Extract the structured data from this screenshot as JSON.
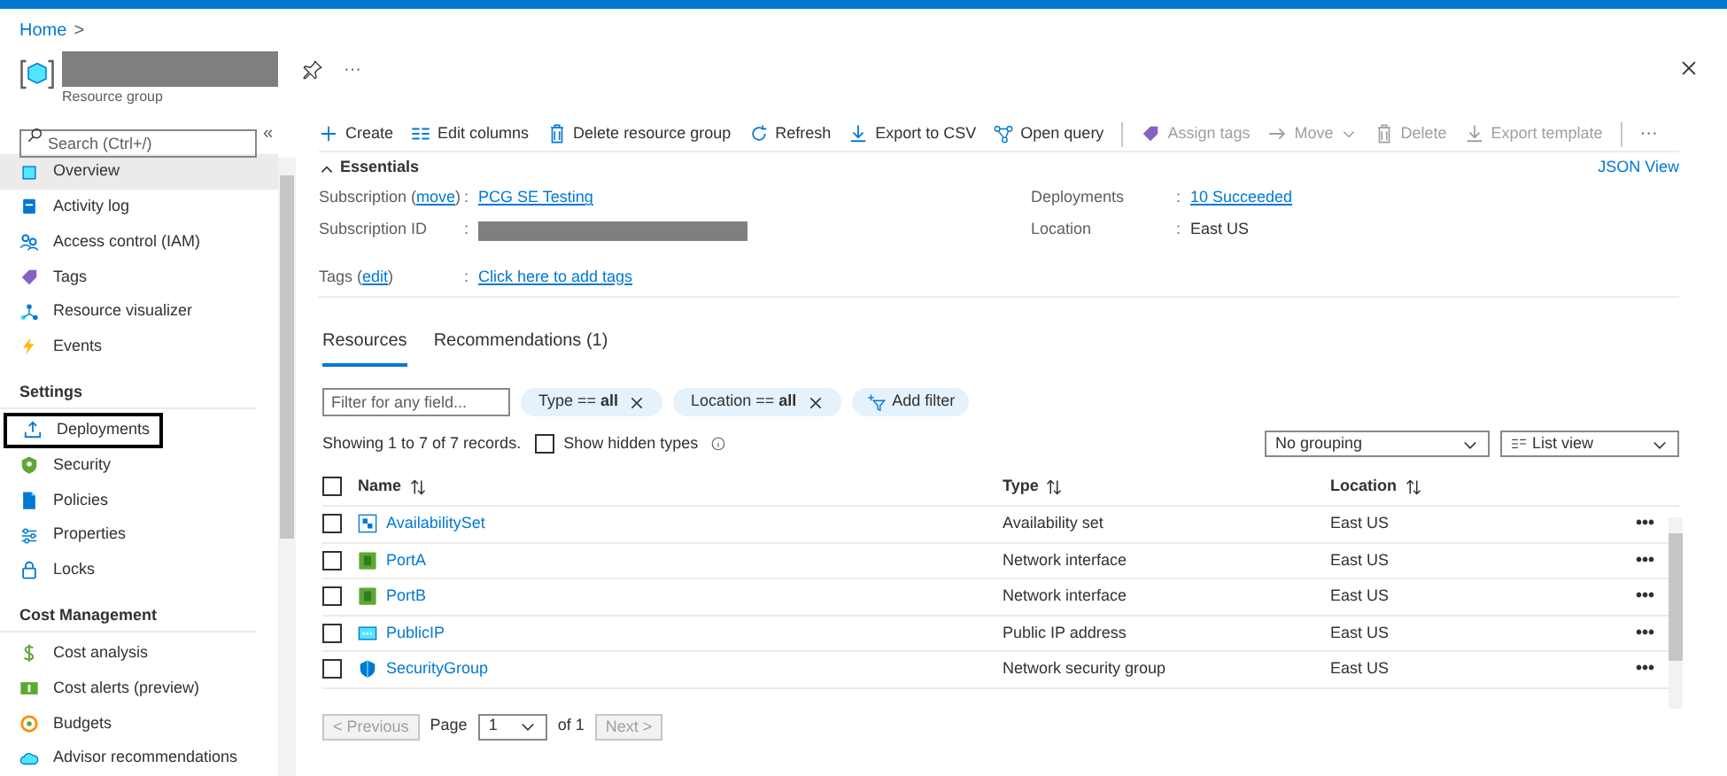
{
  "breadcrumb": [
    "Home",
    ">"
  ],
  "header": {
    "subtitle": "Resource group",
    "more": "···"
  },
  "sidebar": {
    "search_placeholder": "Search (Ctrl+/)",
    "collapse": "«",
    "sections": [
      {
        "items": [
          {
            "label": "Overview",
            "selected": true,
            "highlighted": false
          },
          {
            "label": "Activity log",
            "selected": false,
            "highlighted": false
          },
          {
            "label": "Access control (IAM)",
            "selected": false,
            "highlighted": false
          },
          {
            "label": "Tags",
            "selected": false,
            "highlighted": false
          },
          {
            "label": "Resource visualizer",
            "selected": false,
            "highlighted": false
          },
          {
            "label": "Events",
            "selected": false,
            "highlighted": false
          }
        ]
      },
      {
        "title": "Settings",
        "items": [
          {
            "label": "Deployments",
            "selected": false,
            "highlighted": true
          },
          {
            "label": "Security",
            "selected": false,
            "highlighted": false
          },
          {
            "label": "Policies",
            "selected": false,
            "highlighted": false
          },
          {
            "label": "Properties",
            "selected": false,
            "highlighted": false
          },
          {
            "label": "Locks",
            "selected": false,
            "highlighted": false
          }
        ]
      },
      {
        "title": "Cost Management",
        "items": [
          {
            "label": "Cost analysis",
            "selected": false,
            "highlighted": false
          },
          {
            "label": "Cost alerts (preview)",
            "selected": false,
            "highlighted": false
          },
          {
            "label": "Budgets",
            "selected": false,
            "highlighted": false
          },
          {
            "label": "Advisor recommendations",
            "selected": false,
            "highlighted": false
          }
        ]
      }
    ]
  },
  "toolbar": [
    {
      "label": "Create",
      "disabled": false
    },
    {
      "label": "Edit columns",
      "disabled": false
    },
    {
      "label": "Delete resource group",
      "disabled": false
    },
    {
      "label": "Refresh",
      "disabled": false
    },
    {
      "label": "Export to CSV",
      "disabled": false
    },
    {
      "label": "Open query",
      "disabled": false
    },
    {
      "label": "Assign tags",
      "disabled": true
    },
    {
      "label": "Move",
      "disabled": true
    },
    {
      "label": "Delete",
      "disabled": true
    },
    {
      "label": "Export template",
      "disabled": true
    }
  ],
  "toolbar_more": "···",
  "essentials": {
    "title": "Essentials",
    "json_view": "JSON View",
    "subscription": {
      "label": "Subscription (",
      "link": "move",
      "after_link": ")",
      "colon": ":",
      "value": "PCG SE Testing"
    },
    "subscription_id": {
      "label": "Subscription ID",
      "colon": ":"
    },
    "tags": {
      "label": "Tags (",
      "link": "edit",
      "after_link": ")",
      "colon": ":",
      "value": "Click here to add tags"
    },
    "deployments": {
      "label": "Deployments",
      "colon": ":",
      "value": "10 Succeeded"
    },
    "location": {
      "label": "Location",
      "colon": ":",
      "value": "East US"
    }
  },
  "tabs": [
    {
      "label": "Resources",
      "selected": true
    },
    {
      "label": "Recommendations (1)",
      "selected": false
    }
  ],
  "filter": {
    "placeholder": "Filter for any field...",
    "pills": [
      {
        "key": "Type ==",
        "value": "all"
      },
      {
        "key": "Location ==",
        "value": "all"
      }
    ],
    "add_filter": "Add filter"
  },
  "records": "Showing 1 to 7 of 7 records.",
  "show_hidden": {
    "label": "Show hidden types",
    "checked": false
  },
  "grouping": "No grouping",
  "view": "List view",
  "table": {
    "columns": [
      "Name",
      "Type",
      "Location"
    ],
    "select_all_checked": false,
    "rows": [
      {
        "name": "AvailabilitySet",
        "type": "Availability set",
        "location": "East US",
        "checked": false
      },
      {
        "name": "PortA",
        "type": "Network interface",
        "location": "East US",
        "checked": false
      },
      {
        "name": "PortB",
        "type": "Network interface",
        "location": "East US",
        "checked": false
      },
      {
        "name": "PublicIP",
        "type": "Public IP address",
        "location": "East US",
        "checked": false
      },
      {
        "name": "SecurityGroup",
        "type": "Network security group",
        "location": "East US",
        "checked": false
      }
    ]
  },
  "row_more": "•••",
  "pager": {
    "previous": "< Previous",
    "page": "Page",
    "current": "1",
    "of": "of 1",
    "next": "Next >"
  }
}
